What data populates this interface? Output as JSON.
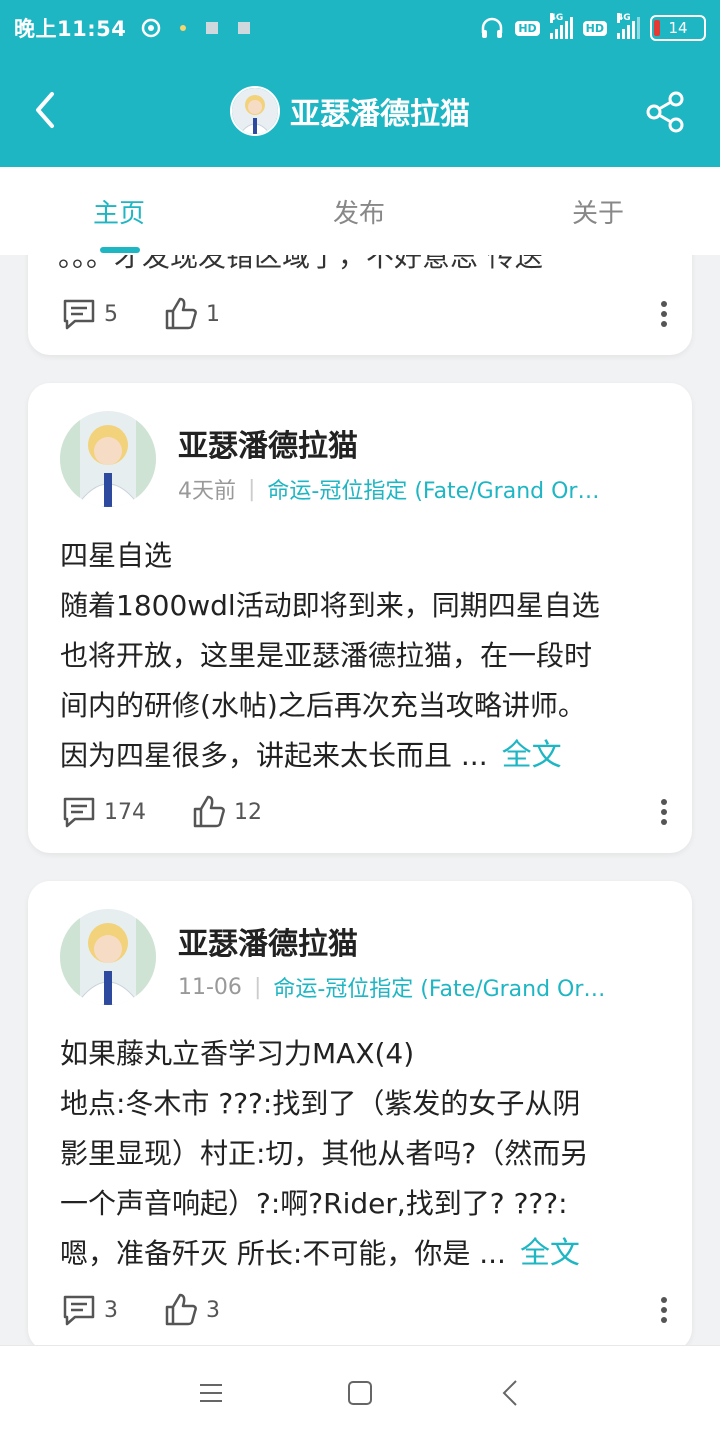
{
  "status_bar": {
    "time": "晚上11:54",
    "hd1": "HD",
    "hd2": "HD",
    "net1": "4G",
    "net2": "4G",
    "battery": "14"
  },
  "header": {
    "title": "亚瑟潘德拉猫"
  },
  "tabs": [
    {
      "label": "主页",
      "active": true
    },
    {
      "label": "发布",
      "active": false
    },
    {
      "label": "关于",
      "active": false
    }
  ],
  "partial_post": {
    "text": "。。。才发现发错区域了，不好意思 传送",
    "comments": "5",
    "likes": "1"
  },
  "posts": [
    {
      "author": "亚瑟潘德拉猫",
      "time": "4天前",
      "category": "命运-冠位指定 (Fate/Grand Or…",
      "lines": [
        "四星自选",
        "随着1800wdl活动即将到来，同期四星自选",
        "也将开放，这里是亚瑟潘德拉猫，在一段时",
        "间内的研修(水帖)之后再次充当攻略讲师。",
        "因为四星很多，讲起来太长而且 ..."
      ],
      "more": "全文",
      "comments": "174",
      "likes": "12"
    },
    {
      "author": "亚瑟潘德拉猫",
      "time": "11-06",
      "category": "命运-冠位指定 (Fate/Grand Or…",
      "lines": [
        "如果藤丸立香学习力MAX(4)",
        "地点:冬木市 ???:找到了（紫发的女子从阴",
        "影里显现）村正:切，其他从者吗?（然而另",
        "一个声音响起）?:啊?Rider,找到了? ???:",
        "嗯，准备歼灭 所长:不可能，你是 ..."
      ],
      "more": "全文",
      "comments": "3",
      "likes": "3"
    }
  ],
  "colors": {
    "accent": "#1fb6c4",
    "background": "#f1f2f3",
    "card": "#ffffff"
  },
  "icons": [
    "back-arrow-icon",
    "share-icon",
    "comment-icon",
    "thumbs-up-icon",
    "more-vertical-icon",
    "menu-icon",
    "home-square-icon",
    "system-back-icon"
  ]
}
